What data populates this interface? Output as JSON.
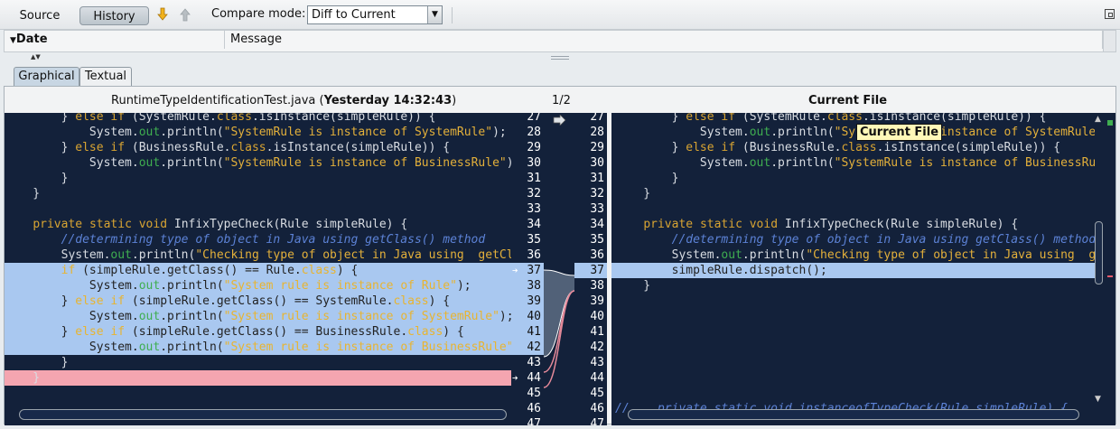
{
  "toolbar": {
    "source_label": "Source",
    "history_label": "History",
    "compare_label": "Compare mode:",
    "compare_value": "Diff to Current"
  },
  "history_table": {
    "date_header": "Date",
    "message_header": "Message"
  },
  "tabs": {
    "graphical": "Graphical",
    "textual": "Textual"
  },
  "diff": {
    "left_file": "RuntimeTypeIdentificationTest.java",
    "left_time": "Yesterday 14:32:43",
    "position": "1/2",
    "right_title": "Current File",
    "tooltip": "Current File",
    "left_lines": [
      {
        "n": "27",
        "t": "        } else if (SystemRule.class.isInstance(simpleRule)) {"
      },
      {
        "n": "28",
        "t": "            System.out.println(\"SystemRule is instance of SystemRule\");"
      },
      {
        "n": "29",
        "t": "        } else if (BusinessRule.class.isInstance(simpleRule)) {"
      },
      {
        "n": "30",
        "t": "            System.out.println(\"SystemRule is instance of BusinessRule\");"
      },
      {
        "n": "31",
        "t": "        }"
      },
      {
        "n": "32",
        "t": "    }"
      },
      {
        "n": "33",
        "t": ""
      },
      {
        "n": "34",
        "t": "    private static void InfixTypeCheck(Rule simpleRule) {"
      },
      {
        "n": "35",
        "t": "        //determining type of object in Java using getClass() method"
      },
      {
        "n": "36",
        "t": "        System.out.println(\"Checking type of object in Java using  getClass()\");"
      },
      {
        "n": "37",
        "t": "        if (simpleRule.getClass() == Rule.class) {"
      },
      {
        "n": "38",
        "t": "            System.out.println(\"System rule is instance of Rule\");"
      },
      {
        "n": "39",
        "t": "        } else if (simpleRule.getClass() == SystemRule.class) {"
      },
      {
        "n": "40",
        "t": "            System.out.println(\"System rule is instance of SystemRule\");"
      },
      {
        "n": "41",
        "t": "        } else if (simpleRule.getClass() == BusinessRule.class) {"
      },
      {
        "n": "42",
        "t": "            System.out.println(\"System rule is instance of BusinessRule\");"
      },
      {
        "n": "43",
        "t": "        }"
      },
      {
        "n": "44",
        "t": "    }"
      },
      {
        "n": "45",
        "t": ""
      },
      {
        "n": "46",
        "t": ""
      },
      {
        "n": "47",
        "t": ""
      }
    ],
    "right_lines": [
      {
        "n": "27",
        "t": "        } else if (SystemRule.class.isInstance(simpleRule)) {"
      },
      {
        "n": "28",
        "t": "            System.out.println(\"SystemRule is instance of SystemRule\");"
      },
      {
        "n": "29",
        "t": "        } else if (BusinessRule.class.isInstance(simpleRule)) {"
      },
      {
        "n": "30",
        "t": "            System.out.println(\"SystemRule is instance of BusinessRule\");"
      },
      {
        "n": "31",
        "t": "        }"
      },
      {
        "n": "32",
        "t": "    }"
      },
      {
        "n": "33",
        "t": ""
      },
      {
        "n": "34",
        "t": "    private static void InfixTypeCheck(Rule simpleRule) {"
      },
      {
        "n": "35",
        "t": "        //determining type of object in Java using getClass() method"
      },
      {
        "n": "36",
        "t": "        System.out.println(\"Checking type of object in Java using  getClass()\");"
      },
      {
        "n": "37",
        "t": "        simpleRule.dispatch();"
      },
      {
        "n": "38",
        "t": "    }"
      },
      {
        "n": "39",
        "t": ""
      },
      {
        "n": "40",
        "t": ""
      },
      {
        "n": "41",
        "t": ""
      },
      {
        "n": "42",
        "t": ""
      },
      {
        "n": "43",
        "t": ""
      },
      {
        "n": "44",
        "t": ""
      },
      {
        "n": "45",
        "t": ""
      },
      {
        "n": "46",
        "t": "//    private static void instanceofTypeCheck(Rule simpleRule) {"
      },
      {
        "n": "47",
        "t": ""
      }
    ]
  },
  "colors": {
    "editor_bg": "#13213a",
    "changed_bg": "#a9c8f0",
    "deleted_bg": "#f4a5b0",
    "keyword": "#d8a432",
    "comment": "#5c82d6"
  }
}
